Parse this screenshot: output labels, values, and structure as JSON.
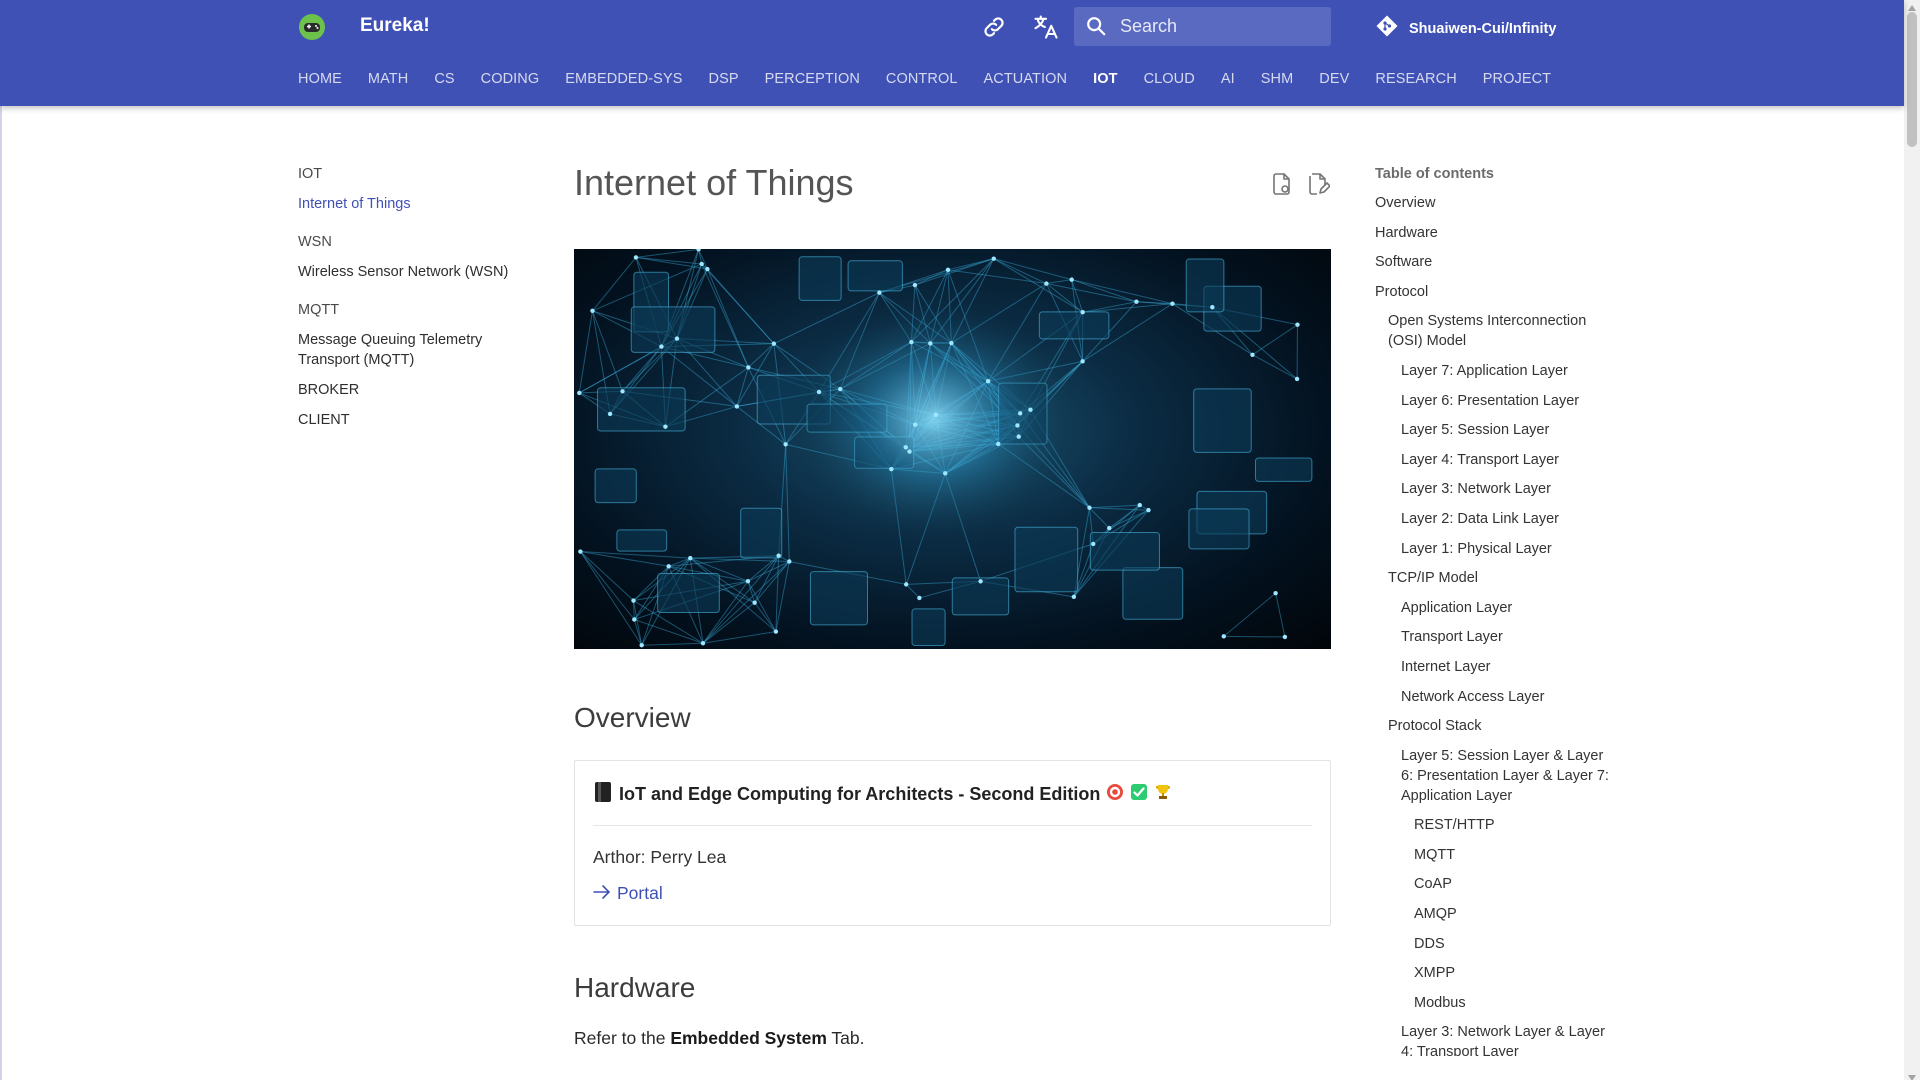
{
  "header": {
    "site_title": "Eureka!",
    "search_placeholder": "Search",
    "repo_label": "Shuaiwen-Cui/Infinity",
    "logo_icon": "gamepad-logo",
    "colors": {
      "primary": "#4051b5",
      "accent": "#4051b5"
    }
  },
  "tabs": [
    {
      "label": "HOME"
    },
    {
      "label": "MATH"
    },
    {
      "label": "CS"
    },
    {
      "label": "CODING"
    },
    {
      "label": "EMBEDDED-SYS"
    },
    {
      "label": "DSP"
    },
    {
      "label": "PERCEPTION"
    },
    {
      "label": "CONTROL"
    },
    {
      "label": "ACTUATION"
    },
    {
      "label": "IOT",
      "active": true
    },
    {
      "label": "CLOUD"
    },
    {
      "label": "AI"
    },
    {
      "label": "SHM"
    },
    {
      "label": "DEV"
    },
    {
      "label": "RESEARCH"
    },
    {
      "label": "PROJECT"
    }
  ],
  "nav": {
    "sections": [
      {
        "title": "IOT",
        "items": [
          "Internet of Things"
        ]
      },
      {
        "title": "WSN",
        "items": [
          "Wireless Sensor Network (WSN)"
        ]
      },
      {
        "title": "MQTT",
        "items": [
          "Message Queuing Telemetry Transport (MQTT)",
          "BROKER",
          "CLIENT"
        ]
      }
    ]
  },
  "main": {
    "title": "Internet of Things",
    "overview_heading": "Overview",
    "book": {
      "title": "IoT and Edge Computing for Architects - Second Edition",
      "author": "Arthor: Perry Lea",
      "link": "Portal"
    },
    "hardware_heading": "Hardware",
    "hardware_text": {
      "prefix": "Refer to the ",
      "bold": "Embedded System",
      "suffix": " Tab."
    }
  },
  "toc": {
    "title": "Table of contents",
    "items": [
      {
        "label": "Overview",
        "level": 1
      },
      {
        "label": "Hardware",
        "level": 1
      },
      {
        "label": "Software",
        "level": 1
      },
      {
        "label": "Protocol",
        "level": 1
      },
      {
        "label": "Open Systems Interconnection (OSI) Model",
        "level": 2
      },
      {
        "label": "Layer 7: Application Layer",
        "level": 3
      },
      {
        "label": "Layer 6: Presentation Layer",
        "level": 3
      },
      {
        "label": "Layer 5: Session Layer",
        "level": 3
      },
      {
        "label": "Layer 4: Transport Layer",
        "level": 3
      },
      {
        "label": "Layer 3: Network Layer",
        "level": 3
      },
      {
        "label": "Layer 2: Data Link Layer",
        "level": 3
      },
      {
        "label": "Layer 1: Physical Layer",
        "level": 3
      },
      {
        "label": "TCP/IP Model",
        "level": 2
      },
      {
        "label": "Application Layer",
        "level": 3
      },
      {
        "label": "Transport Layer",
        "level": 3
      },
      {
        "label": "Internet Layer",
        "level": 3
      },
      {
        "label": "Network Access Layer",
        "level": 3
      },
      {
        "label": "Protocol Stack",
        "level": 2
      },
      {
        "label": "Layer 5: Session Layer & Layer 6: Presentation Layer & Layer 7: Application Layer",
        "level": 3
      },
      {
        "label": "REST/HTTP",
        "level": 4
      },
      {
        "label": "MQTT",
        "level": 4
      },
      {
        "label": "CoAP",
        "level": 4
      },
      {
        "label": "AMQP",
        "level": 4
      },
      {
        "label": "DDS",
        "level": 4
      },
      {
        "label": "XMPP",
        "level": 4
      },
      {
        "label": "Modbus",
        "level": 4
      },
      {
        "label": "Layer 3: Network Layer & Layer 4: Transport Layer",
        "level": 3
      }
    ]
  }
}
